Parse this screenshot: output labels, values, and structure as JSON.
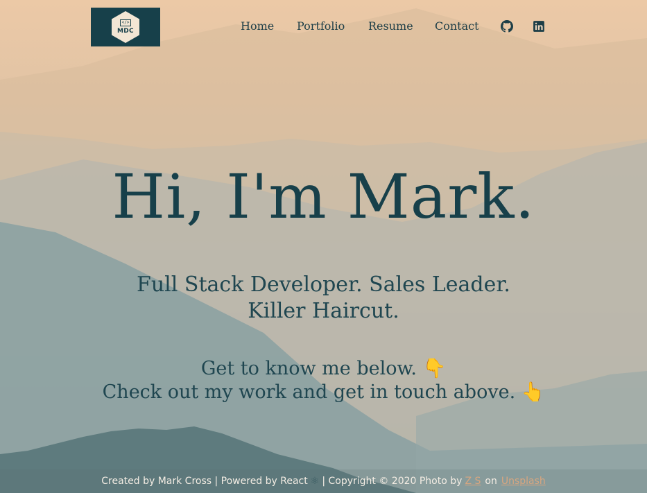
{
  "logo": {
    "code_glyph": "</>",
    "text": "MDC"
  },
  "nav": {
    "items": [
      {
        "label": "Home"
      },
      {
        "label": "Portfolio"
      },
      {
        "label": "Resume"
      },
      {
        "label": "Contact"
      }
    ],
    "icons": [
      "github-icon",
      "linkedin-icon"
    ]
  },
  "hero": {
    "heading": "Hi, I'm Mark.",
    "tagline_line1": "Full Stack Developer. Sales Leader.",
    "tagline_line2": "Killer Haircut.",
    "know_line1": "Get to know me below. 👇",
    "know_line2": "Check out my work and get in touch above. 👆"
  },
  "footer": {
    "created": "Created by Mark Cross | Powered by React",
    "react_glyph": "⚛",
    "copyright": "| Copyright © 2020  Photo by",
    "photographer": "Z S",
    "on": "on",
    "site": "Unsplash"
  },
  "colors": {
    "primary": "#17404a",
    "text": "#1f4650",
    "footer_text": "#f4ede4",
    "footer_link": "#d9a67f"
  }
}
